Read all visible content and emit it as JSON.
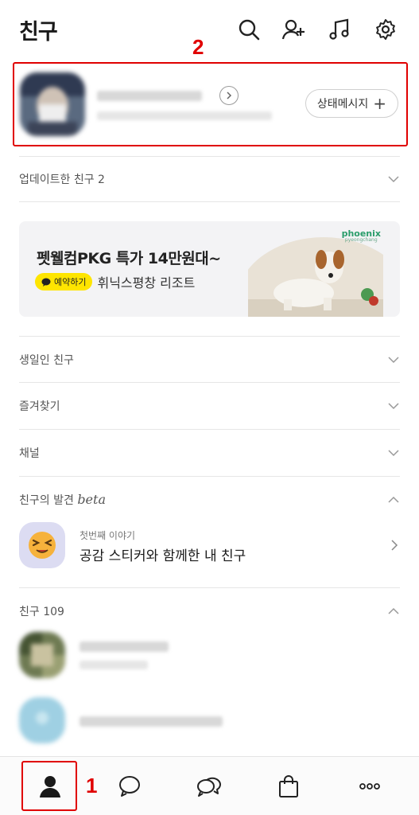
{
  "header": {
    "title": "친구",
    "icons": [
      "search-icon",
      "add-friend-icon",
      "music-icon",
      "settings-icon"
    ]
  },
  "annotations": {
    "label_1": "1",
    "label_2": "2",
    "box_color": "#e00000"
  },
  "profile": {
    "status_button": "상태메시지",
    "status_plus": "+"
  },
  "sections": {
    "updated_friends": "업데이트한 친구 2",
    "birthday": "생일인 친구",
    "favorites": "즐겨찾기",
    "channels": "채널",
    "discover_prefix": "친구의 발견 ",
    "discover_beta": "beta",
    "friends_count": "친구 109"
  },
  "banner": {
    "headline": "펫웰컴PKG 특가 14만원대~",
    "badge": "예약하기",
    "place": "휘닉스평창 리조트",
    "brand": "phoenix",
    "brand_sub": "pyeongchang"
  },
  "discover": {
    "small": "첫번째 이야기",
    "big": "공감 스티커와 함께한 내 친구"
  },
  "tabbar": {
    "tabs": [
      "friends-tab",
      "chats-tab",
      "openchat-tab",
      "shopping-tab",
      "more-tab"
    ],
    "active": "friends-tab"
  },
  "colors": {
    "accent_yellow": "#fee500",
    "annotation_red": "#e00000"
  }
}
